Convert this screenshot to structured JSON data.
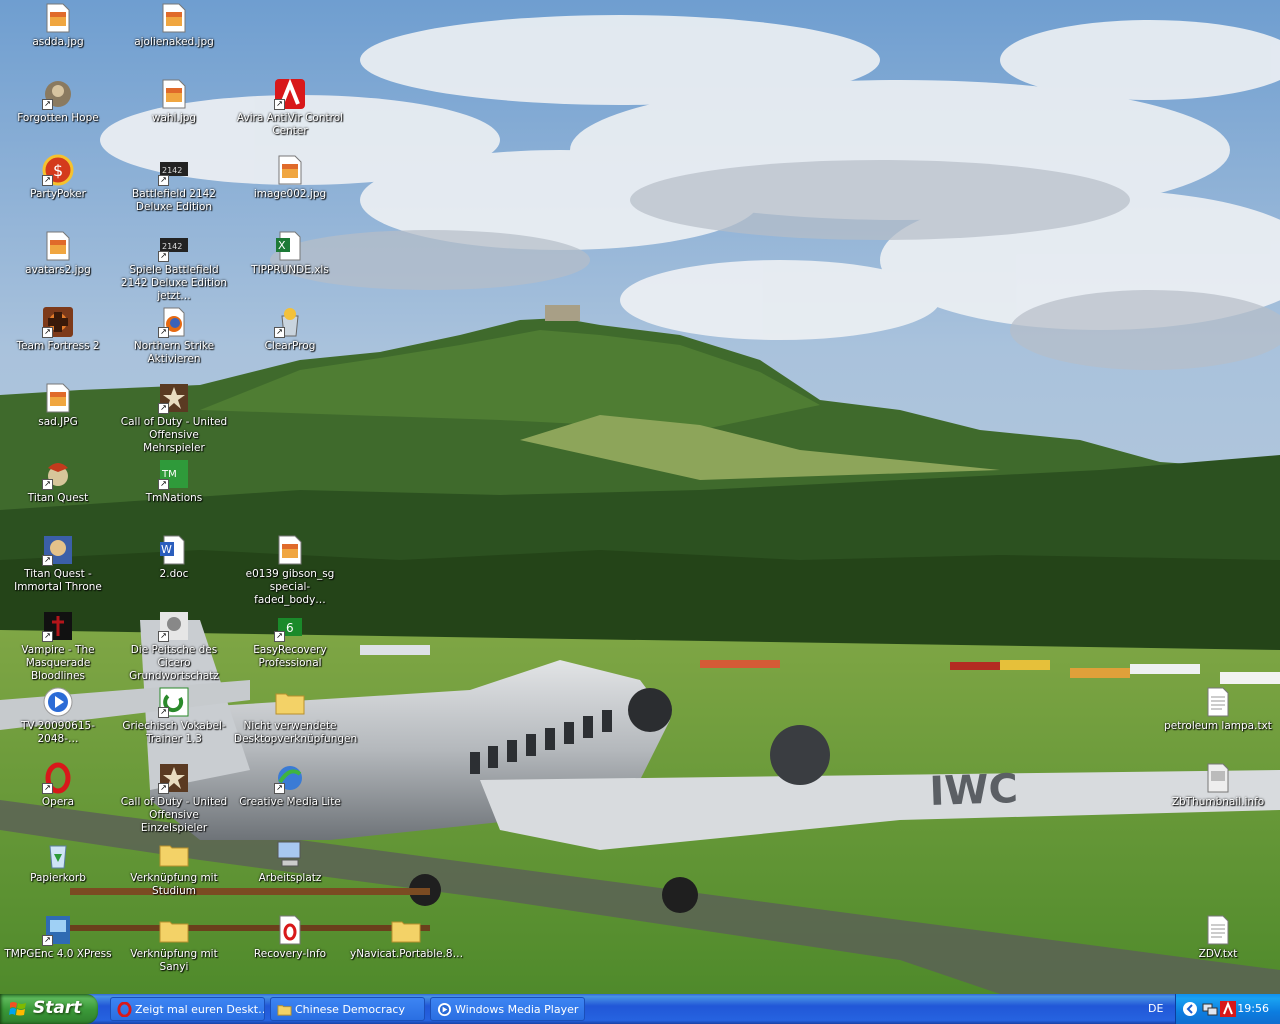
{
  "desktop": {
    "icons": [
      {
        "label": "asdda.jpg",
        "type": "image"
      },
      {
        "label": "ajolienaked.jpg",
        "type": "image"
      },
      {
        "label": "Forgotten Hope",
        "type": "game"
      },
      {
        "label": "wahl.jpg",
        "type": "image"
      },
      {
        "label": "Avira AntiVir Control Center",
        "type": "avira"
      },
      {
        "label": "PartyPoker",
        "type": "poker"
      },
      {
        "label": "Battlefield 2142 Deluxe Edition",
        "type": "bf"
      },
      {
        "label": "image002.jpg",
        "type": "image"
      },
      {
        "label": "avatars2.jpg",
        "type": "image"
      },
      {
        "label": "Spiele Battlefield 2142 Deluxe Edition jetzt…",
        "type": "bf"
      },
      {
        "label": "TIPPRUNDE.xls",
        "type": "excel"
      },
      {
        "label": "Team Fortress 2",
        "type": "tf2"
      },
      {
        "label": "Northern Strike Aktivieren",
        "type": "firefox"
      },
      {
        "label": "ClearProg",
        "type": "clearprog"
      },
      {
        "label": "sad.JPG",
        "type": "image"
      },
      {
        "label": "Call of Duty - United Offensive Mehrspieler",
        "type": "cod"
      },
      {
        "label": "Titan Quest",
        "type": "titan"
      },
      {
        "label": "TmNations",
        "type": "tm"
      },
      {
        "label": "Titan Quest - Immortal Throne",
        "type": "titan2"
      },
      {
        "label": "2.doc",
        "type": "word"
      },
      {
        "label": "e0139 gibson_sg special-faded_body…",
        "type": "image"
      },
      {
        "label": "Vampire - The Masquerade Bloodlines",
        "type": "vampire"
      },
      {
        "label": "Die Peitsche des Cicero Grundwortschatz",
        "type": "cicero"
      },
      {
        "label": "EasyRecovery Professional",
        "type": "easy"
      },
      {
        "label": "TV-20090615-2048-…",
        "type": "media"
      },
      {
        "label": "Griechisch Vokabel-Trainer 1.3",
        "type": "greek"
      },
      {
        "label": "Nicht verwendete Desktopverknüpfungen",
        "type": "folder"
      },
      {
        "label": "Opera",
        "type": "opera"
      },
      {
        "label": "Call of Duty - United Offensive Einzelspieler",
        "type": "cod"
      },
      {
        "label": "Creative Media Lite",
        "type": "creative"
      },
      {
        "label": "Papierkorb",
        "type": "recycle"
      },
      {
        "label": "Verknüpfung mit Studium",
        "type": "folder"
      },
      {
        "label": "Arbeitsplatz",
        "type": "computer"
      },
      {
        "label": "TMPGEnc 4.0 XPress",
        "type": "tmpg"
      },
      {
        "label": "Verknüpfung mit Sanyi",
        "type": "folder"
      },
      {
        "label": "Recovery-Info",
        "type": "recovery"
      },
      {
        "label": "yNavicat.Portable.8…",
        "type": "folder"
      },
      {
        "label": "petroleum lampa.txt",
        "type": "txt"
      },
      {
        "label": "ZbThumbnail.info",
        "type": "info"
      },
      {
        "label": "ZDV.txt",
        "type": "txt"
      }
    ]
  },
  "taskbar": {
    "start_label": "Start",
    "tasks": [
      {
        "label": "Zeigt mal euren Deskt…",
        "icon": "opera-icon"
      },
      {
        "label": "Chinese Democracy",
        "icon": "folder-icon"
      },
      {
        "label": "Windows Media Player",
        "icon": "media-player-icon"
      }
    ],
    "language": "DE",
    "clock": "19:56"
  }
}
